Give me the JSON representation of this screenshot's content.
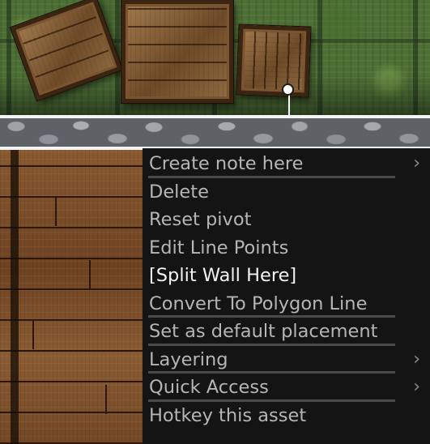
{
  "context_menu": {
    "items": [
      {
        "label": "Create note here",
        "submenu_icon": "›"
      },
      {
        "label": "Delete"
      },
      {
        "label": "Reset pivot"
      },
      {
        "label": "Edit Line Points"
      },
      {
        "label": "[Split Wall Here]"
      },
      {
        "label": "Convert To Polygon Line"
      },
      {
        "label": "Set as default placement"
      },
      {
        "label": "Layering",
        "submenu_icon": "›"
      },
      {
        "label": "Quick Access",
        "submenu_icon": "›"
      },
      {
        "label": "Hotkey this asset"
      }
    ]
  },
  "colors": {
    "menu_bg": "#141414",
    "menu_text": "#b5b5b5",
    "menu_text_highlight": "#f2f2f2",
    "wall_line": "#f4f4f4"
  }
}
